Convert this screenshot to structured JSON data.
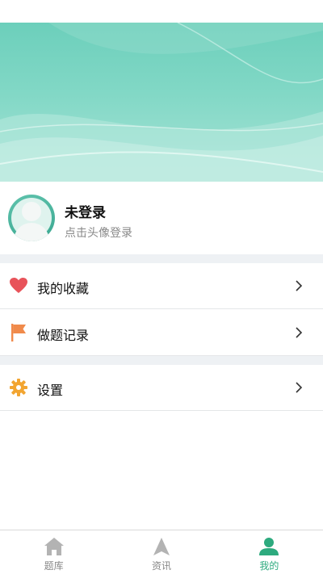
{
  "profile": {
    "title": "未登录",
    "subtitle": "点击头像登录"
  },
  "menu": [
    {
      "label": "我的收藏",
      "icon": "heart-icon"
    },
    {
      "label": "做题记录",
      "icon": "flag-icon"
    },
    {
      "label": "设置",
      "icon": "gear-icon"
    }
  ],
  "tabbar": {
    "items": [
      {
        "label": "题库",
        "icon": "home-icon"
      },
      {
        "label": "资讯",
        "icon": "navigation-arrow-icon"
      },
      {
        "label": "我的",
        "icon": "user-icon"
      }
    ],
    "active": "我的"
  },
  "colors": {
    "accent": "#2daa7e",
    "heart": "#e8535a",
    "flag": "#f08a4b",
    "gear": "#f2a531",
    "banner": "#82d8c6"
  }
}
